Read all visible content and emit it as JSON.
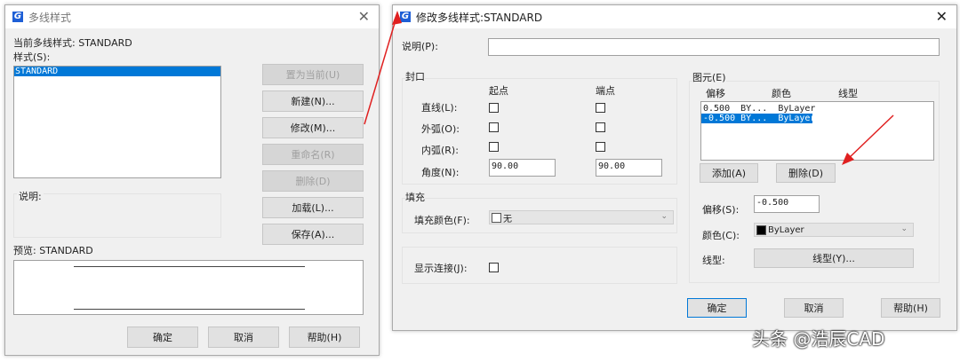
{
  "left_dialog": {
    "title": "多线样式",
    "current_label": "当前多线样式:  STANDARD",
    "styles_label": "样式(S):",
    "styles": [
      "STANDARD"
    ],
    "buttons": {
      "set_current": "置为当前(U)",
      "new": "新建(N)...",
      "modify": "修改(M)...",
      "rename": "重命名(R)",
      "delete": "删除(D)",
      "load": "加载(L)...",
      "save": "保存(A)..."
    },
    "description_label": "说明:",
    "preview_label": "预览:  STANDARD",
    "ok": "确定",
    "cancel": "取消",
    "help": "帮助(H)"
  },
  "right_dialog": {
    "title": "修改多线样式:STANDARD",
    "description_label": "说明(P):",
    "description_value": "",
    "caps": {
      "title": "封口",
      "start": "起点",
      "end": "端点",
      "rows": [
        {
          "label": "直线(L):"
        },
        {
          "label": "外弧(O):"
        },
        {
          "label": "内弧(R):"
        }
      ],
      "angle_label": "角度(N):",
      "angle_start": "90.00",
      "angle_end": "90.00"
    },
    "fill": {
      "title": "填充",
      "color_label": "填充颜色(F):",
      "color_value": "无"
    },
    "joints_label": "显示连接(J):",
    "elements": {
      "title": "图元(E)",
      "headers": [
        "偏移",
        "颜色",
        "线型"
      ],
      "rows": [
        {
          "offset": "0.500",
          "color": "BY...",
          "linetype": "ByLayer"
        },
        {
          "offset": "-0.500",
          "color": "BY...",
          "linetype": "ByLayer"
        }
      ],
      "add": "添加(A)",
      "delete": "删除(D)",
      "offset_label": "偏移(S):",
      "offset_value": "-0.500",
      "color_label": "颜色(C):",
      "color_value": "ByLayer",
      "linetype_label": "线型:",
      "linetype_button": "线型(Y)..."
    },
    "ok": "确定",
    "cancel": "取消",
    "help": "帮助(H)"
  },
  "watermark": "头条 @浩辰CAD",
  "colors": {
    "accent": "#0078d7",
    "arrow": "#e02020"
  }
}
